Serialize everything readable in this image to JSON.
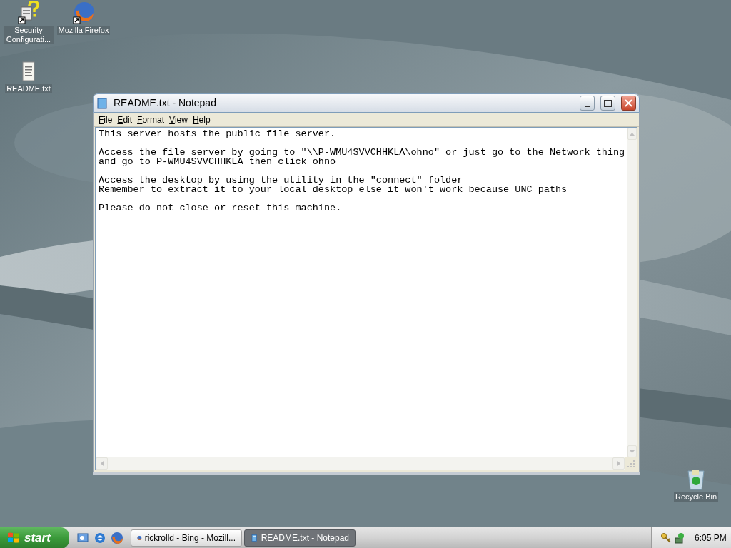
{
  "desktop_icons": [
    {
      "label": "Security Configurati...",
      "kind": "help-shortcut"
    },
    {
      "label": "Mozilla Firefox",
      "kind": "firefox-shortcut"
    },
    {
      "label": "README.txt",
      "kind": "text-file"
    },
    {
      "label": "Recycle Bin",
      "kind": "recycle-bin"
    }
  ],
  "window": {
    "title": "README.txt - Notepad",
    "menu": [
      "File",
      "Edit",
      "Format",
      "View",
      "Help"
    ],
    "paragraphs": [
      [
        "This server hosts the public file server."
      ],
      [
        "Access the file server by going to \"\\\\P-WMU4SVVCHHKLA\\ohno\" or just go to the Network thing",
        "and go to P-WMU4SVVCHHKLA then click ohno"
      ],
      [
        "Access the desktop by using the utility in the \"connect\" folder",
        "Remember to extract it to your local desktop else it won't work because UNC paths"
      ],
      [
        "Please do not close or reset this machine."
      ]
    ]
  },
  "taskbar": {
    "start": "start",
    "quick_launch": [
      {
        "kind": "desktop"
      },
      {
        "kind": "ie"
      },
      {
        "kind": "firefox"
      }
    ],
    "tasks": [
      {
        "label": "rickrolld - Bing - Mozill...",
        "kind": "firefox",
        "selected": false
      },
      {
        "label": "README.txt - Notepad",
        "kind": "notepad",
        "selected": true
      }
    ],
    "clock": "6:05 PM"
  }
}
